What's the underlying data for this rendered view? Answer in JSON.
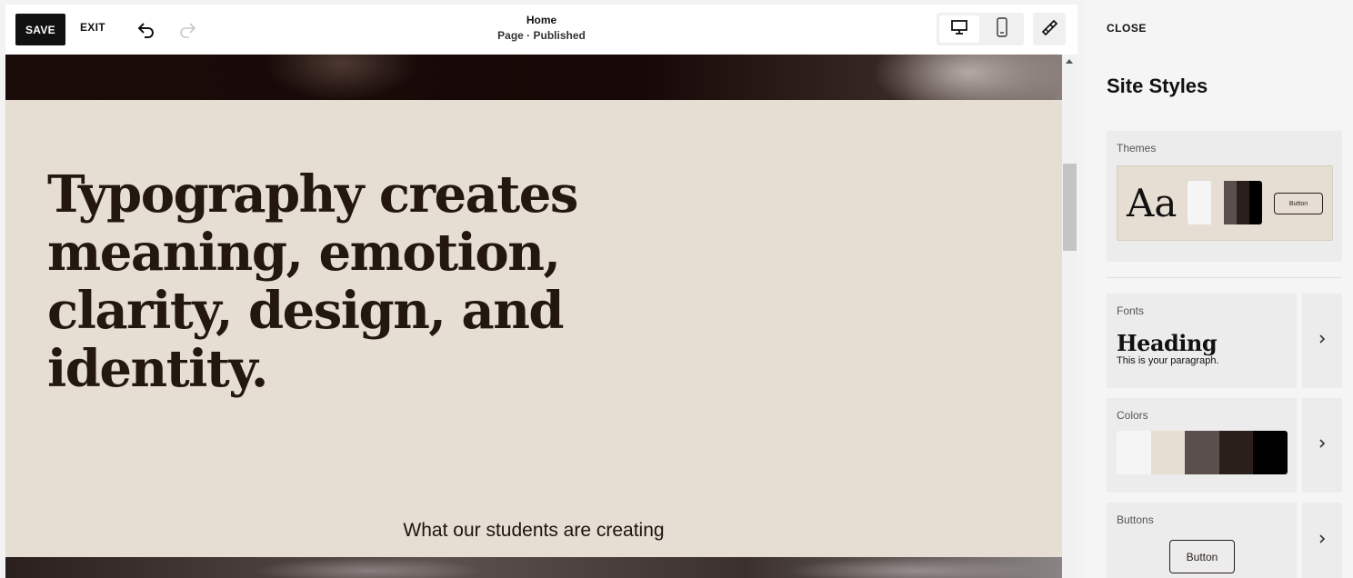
{
  "toolbar": {
    "save_label": "SAVE",
    "exit_label": "EXIT",
    "page_title": "Home",
    "page_status": "Page · Published",
    "undo_icon": "undo-icon",
    "redo_icon": "redo-icon",
    "desktop_icon": "desktop-icon",
    "mobile_icon": "mobile-icon",
    "style_icon": "paintbrush-icon"
  },
  "page": {
    "hero_heading": "Typography creates meaning, emotion, clarity, design, and identity.",
    "section_caption": "What our students are creating"
  },
  "panel": {
    "close_label": "CLOSE",
    "title": "Site Styles",
    "themes": {
      "label": "Themes",
      "preview_text": "Aa",
      "button_text": "Button",
      "swatches": [
        "#f5f5f5",
        "#e6ddd3",
        "#5a4f4c",
        "#2a1f1b",
        "#000000"
      ]
    },
    "fonts": {
      "label": "Fonts",
      "heading_sample": "Heading",
      "paragraph_sample": "This is your paragraph."
    },
    "colors": {
      "label": "Colors",
      "swatches": [
        "#f5f5f5",
        "#e6ddd3",
        "#5a4f4c",
        "#2a1f1b",
        "#000000"
      ]
    },
    "buttons": {
      "label": "Buttons",
      "sample_text": "Button"
    },
    "chevron_icon": "chevron-right-icon"
  },
  "colors": {
    "accent_dark": "#111111",
    "page_background": "#e6ddd3",
    "heading_color": "#23170f"
  }
}
